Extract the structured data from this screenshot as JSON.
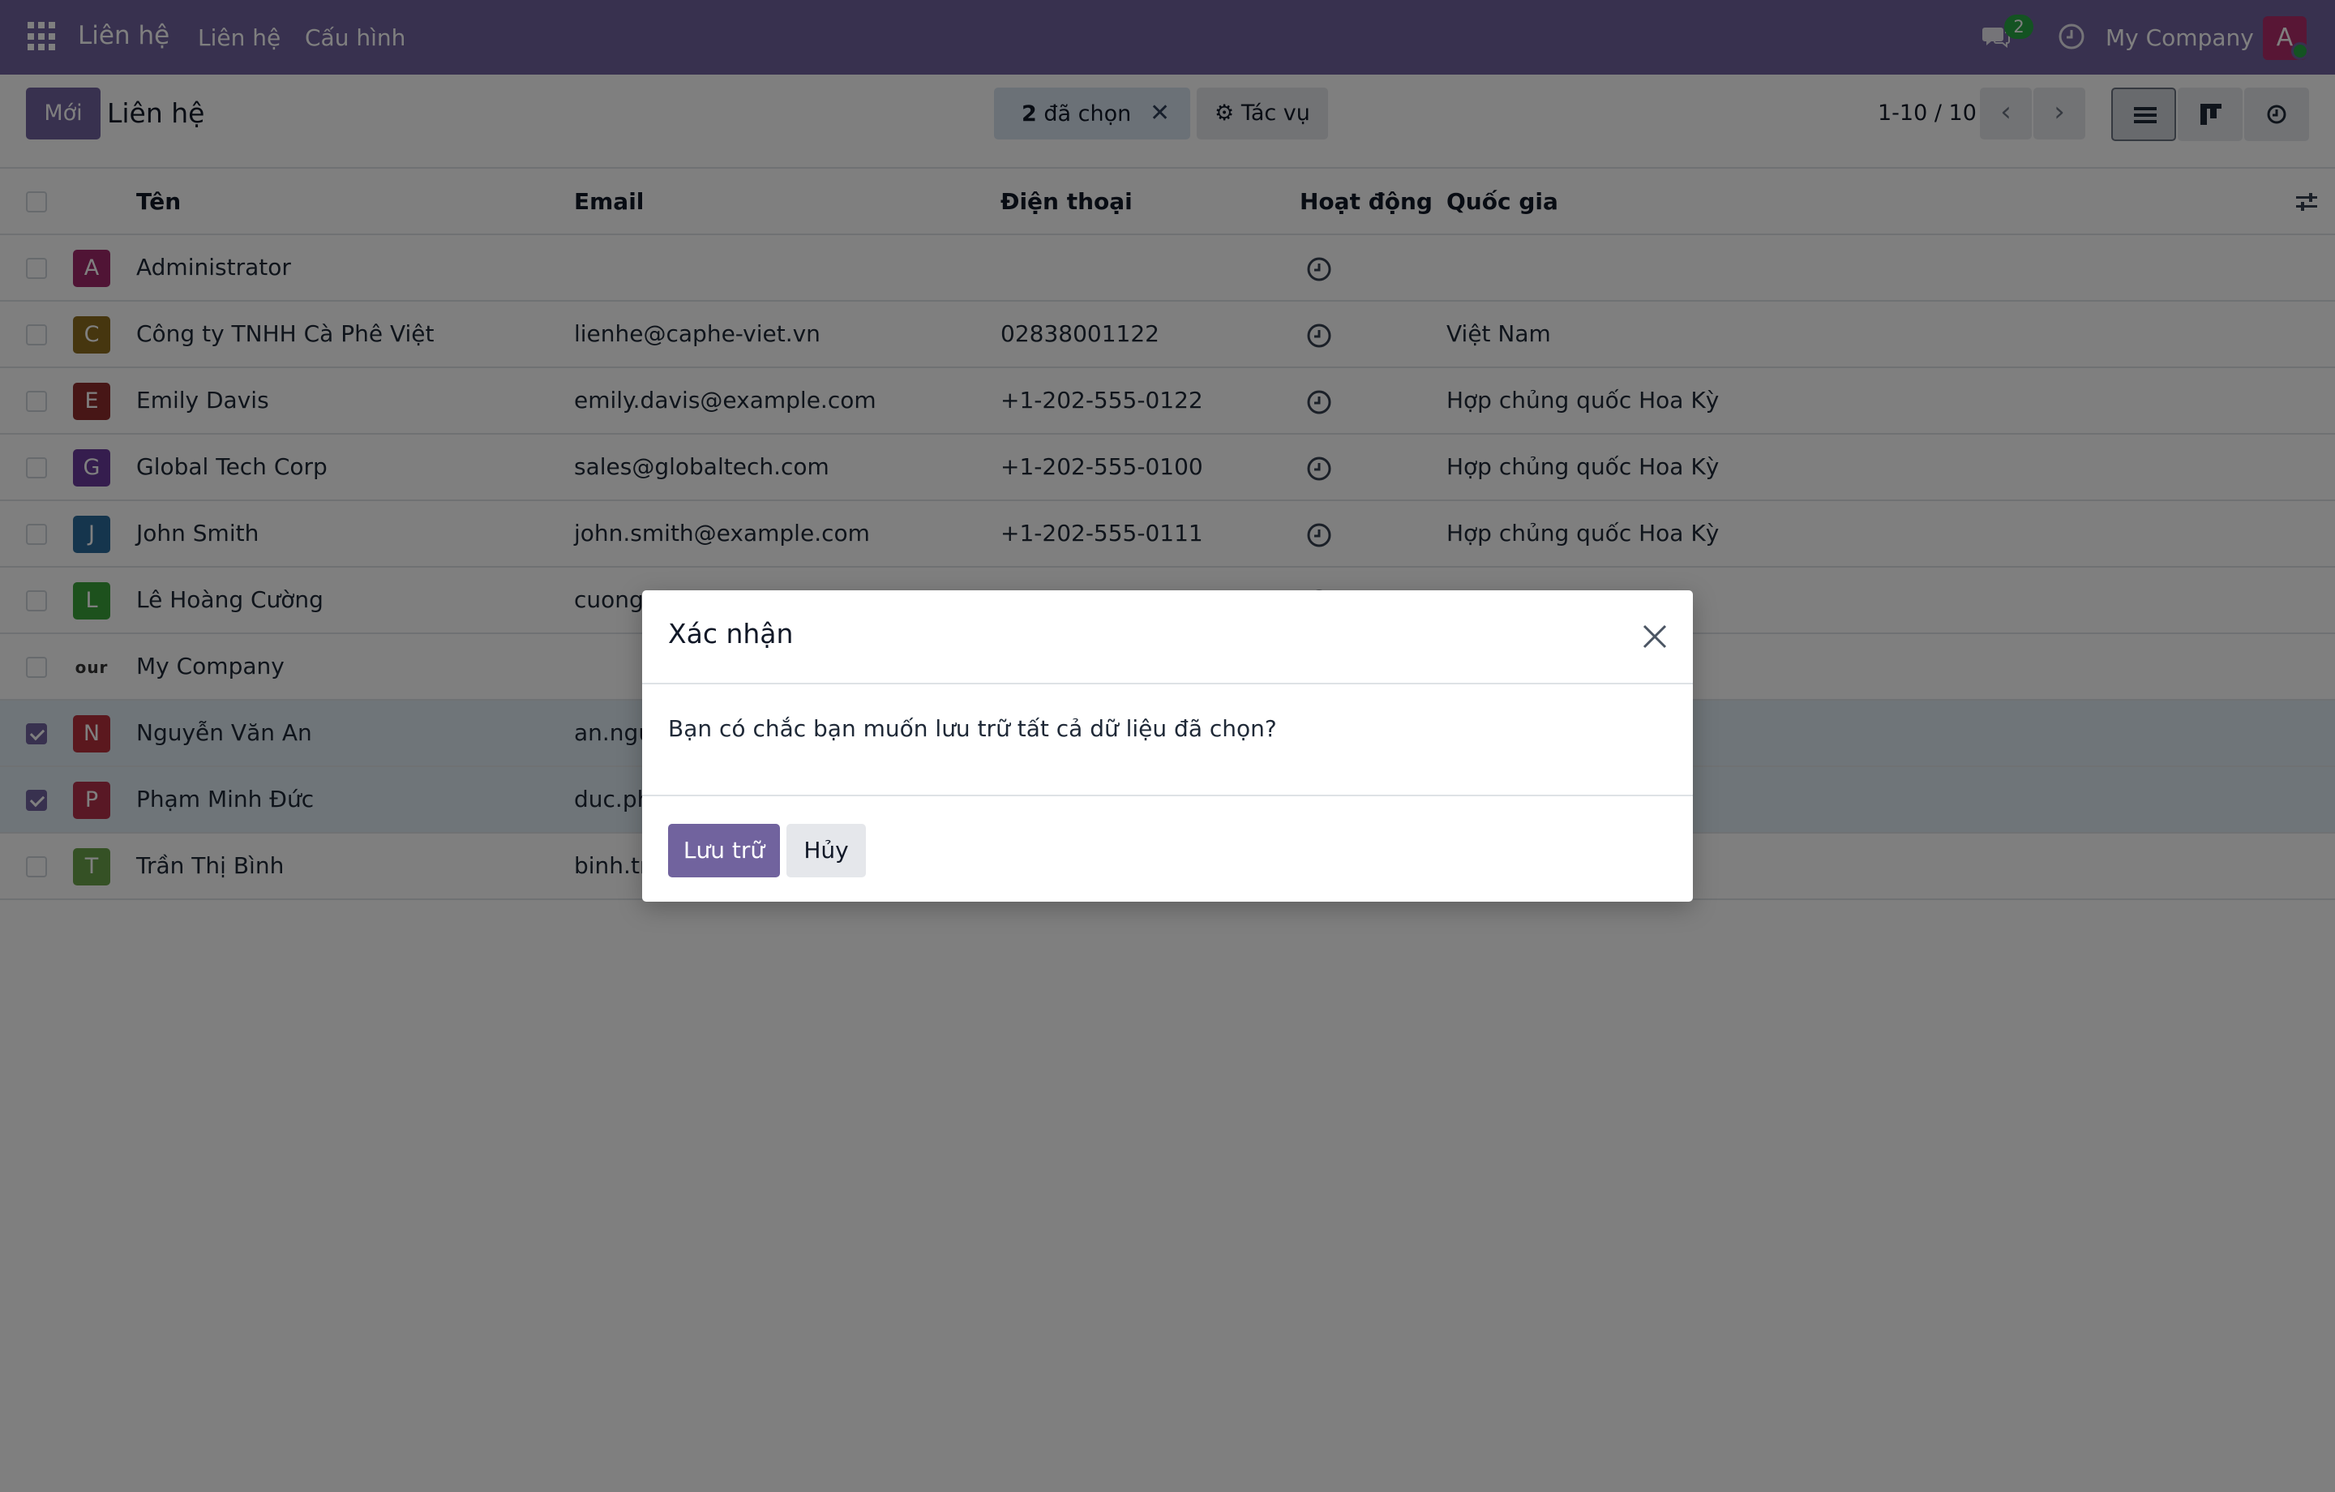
{
  "navbar": {
    "brand": "Liên hệ",
    "menu": [
      "Liên hệ",
      "Cấu hình"
    ],
    "chat_count": "2",
    "company": "My Company",
    "user_initial": "A",
    "accent_color": "#71639e"
  },
  "control_panel": {
    "new_label": "Mới",
    "title": "Liên hệ",
    "selection_count": "2",
    "selection_label": "đã chọn",
    "actions_label": "Tác vụ",
    "pager": "1-10 / 10"
  },
  "table": {
    "columns": [
      "Tên",
      "Email",
      "Điện thoại",
      "Hoạt động",
      "Quốc gia"
    ],
    "rows": [
      {
        "initial": "A",
        "name": "Administrator",
        "email": "",
        "phone": "",
        "country": "",
        "color": "#a1286a",
        "selected": false
      },
      {
        "initial": "C",
        "name": "Công ty TNHH Cà Phê Việt",
        "email": "lienhe@caphe-viet.vn",
        "phone": "02838001122",
        "country": "Việt Nam",
        "color": "#8c6d1e",
        "selected": false
      },
      {
        "initial": "E",
        "name": "Emily Davis",
        "email": "emily.davis@example.com",
        "phone": "+1-202-555-0122",
        "country": "Hợp chủng quốc Hoa Kỳ",
        "color": "#8e2c2c",
        "selected": false
      },
      {
        "initial": "G",
        "name": "Global Tech Corp",
        "email": "sales@globaltech.com",
        "phone": "+1-202-555-0100",
        "country": "Hợp chủng quốc Hoa Kỳ",
        "color": "#6a3a9c",
        "selected": false
      },
      {
        "initial": "J",
        "name": "John Smith",
        "email": "john.smith@example.com",
        "phone": "+1-202-555-0111",
        "country": "Hợp chủng quốc Hoa Kỳ",
        "color": "#2a6a9a",
        "selected": false
      },
      {
        "initial": "L",
        "name": "Lê Hoàng Cường",
        "email": "cuong",
        "phone": "",
        "country": "",
        "color": "#3aa23a",
        "selected": false
      },
      {
        "initial": "our l",
        "name": "My Company",
        "email": "",
        "phone": "",
        "country": "",
        "color": "#ffffff",
        "selected": false,
        "company_logo": true
      },
      {
        "initial": "N",
        "name": "Nguyễn Văn An",
        "email": "an.ngu",
        "phone": "",
        "country": "",
        "color": "#b6303c",
        "selected": true
      },
      {
        "initial": "P",
        "name": "Phạm Minh Đức",
        "email": "duc.ph",
        "phone": "",
        "country": "",
        "color": "#b3304b",
        "selected": true
      },
      {
        "initial": "T",
        "name": "Trần Thị Bình",
        "email": "binh.tr",
        "phone": "",
        "country": "",
        "color": "#6aa34a",
        "selected": false
      }
    ]
  },
  "modal": {
    "title": "Xác nhận",
    "message": "Bạn có chắc bạn muốn lưu trữ tất cả dữ liệu đã chọn?",
    "confirm_label": "Lưu trữ",
    "cancel_label": "Hủy"
  }
}
